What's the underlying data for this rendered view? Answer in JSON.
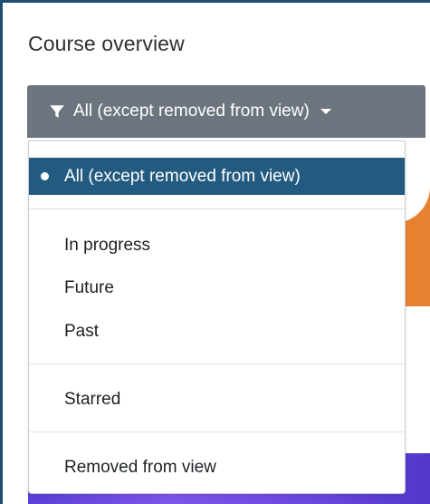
{
  "block": {
    "title": "Course overview"
  },
  "filter": {
    "button_label": "All (except removed from view)",
    "button_icon": "filter-icon",
    "caret_icon": "caret-down-icon"
  },
  "menu": {
    "items": [
      {
        "label": "All (except removed from view)",
        "selected": true
      },
      {
        "label": "In progress",
        "selected": false
      },
      {
        "label": "Future",
        "selected": false
      },
      {
        "label": "Past",
        "selected": false
      },
      {
        "label": "Starred",
        "selected": false
      },
      {
        "label": "Removed from view",
        "selected": false
      }
    ]
  },
  "colors": {
    "button_bg": "#6c757d",
    "selected_bg": "#235b80",
    "frame_border": "#1f4e72",
    "course_card_orange": "#e8812f",
    "course_card_purple": "#6a47dd"
  }
}
